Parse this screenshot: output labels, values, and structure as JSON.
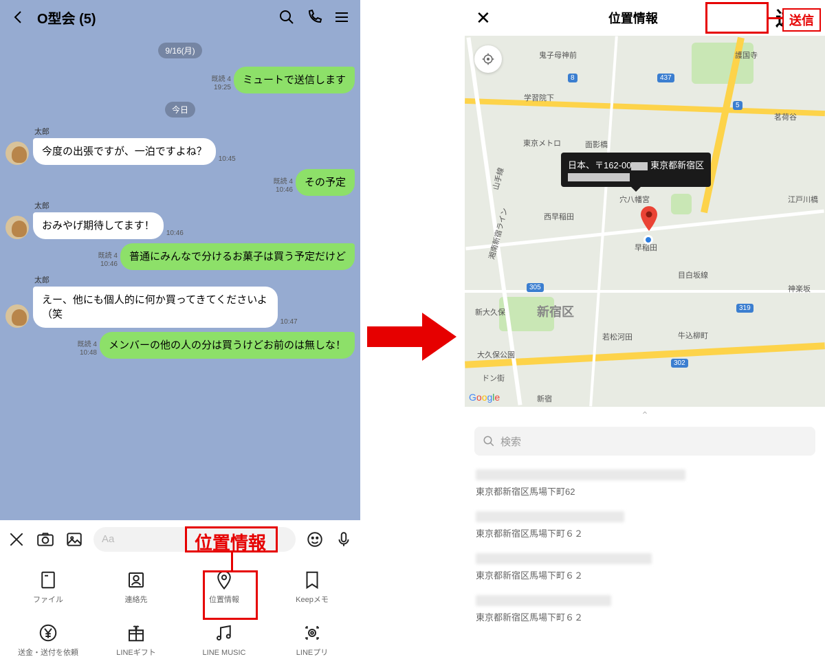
{
  "left": {
    "header": {
      "title": "O型会 (5)"
    },
    "dates": {
      "d1": "9/16(月)",
      "d2": "今日"
    },
    "msgs": {
      "m1": {
        "text": "ミュートで送信します",
        "read": "既読 4",
        "time": "19:25"
      },
      "m2": {
        "sender": "太郎",
        "text": "今度の出張ですが、一泊ですよね？",
        "time": "10:45"
      },
      "m3": {
        "text": "その予定",
        "read": "既読 4",
        "time": "10:46"
      },
      "m4": {
        "sender": "太郎",
        "text": "おみやげ期待してます！",
        "time": "10:46"
      },
      "m5": {
        "text": "普通にみんなで分けるお菓子は買う予定だけど",
        "read": "既読 4",
        "time": "10:46"
      },
      "m6": {
        "sender": "太郎",
        "text": "えー、他にも個人的に何か買ってきてくださいよ（笑",
        "time": "10:47"
      },
      "m7": {
        "text": "メンバーの他の人の分は買うけどお前のは無しな！",
        "read": "既読 4",
        "time": "10:48"
      }
    },
    "input": {
      "placeholder": "Aa"
    },
    "attach": {
      "file": "ファイル",
      "contact": "連絡先",
      "location": "位置情報",
      "keep": "Keepメモ",
      "money": "送金・送付を依頼",
      "gift": "LINEギフト",
      "music": "LINE MUSIC",
      "print": "LINEプリ"
    },
    "callout": {
      "label": "位置情報"
    }
  },
  "right": {
    "header": {
      "title": "位置情報",
      "send": "送信"
    },
    "callout": {
      "label": "送信"
    },
    "map": {
      "tooltip": "日本、〒162-00██ 東京都新宿区████████",
      "labels": {
        "kishibojin": "鬼子母神前",
        "gokokuji": "護国寺",
        "gakushuin": "学習院下",
        "myoga": "茗荷谷",
        "metro": "東京メトロ",
        "eishobashi": "面影橋",
        "nishiwaseda": "西早稲田",
        "anahachiman": "穴八幡宮",
        "waseda": "早稲田",
        "edogawa": "江戸川橋",
        "shinokubo": "新大久保",
        "shinjukuku": "新宿区",
        "mejiro": "目白坂線",
        "wakamatsu": "若松河田",
        "ushigome": "牛込柳町",
        "kagurazaka": "神楽坂",
        "okubopark": "大久保公園",
        "dongai": "ドン街",
        "shinjuku": "新宿",
        "yamate": "山手線",
        "shonan": "湘南新宿ライン"
      },
      "routes": {
        "r8": "8",
        "r437": "437",
        "r5": "5",
        "r305": "305",
        "r302": "302",
        "r319": "319"
      }
    },
    "search": {
      "placeholder": "検索"
    },
    "results": {
      "r1": "東京都新宿区馬場下町62",
      "r2": "東京都新宿区馬場下町６２",
      "r3": "東京都新宿区馬場下町６２",
      "r4": "東京都新宿区馬場下町６２"
    }
  }
}
